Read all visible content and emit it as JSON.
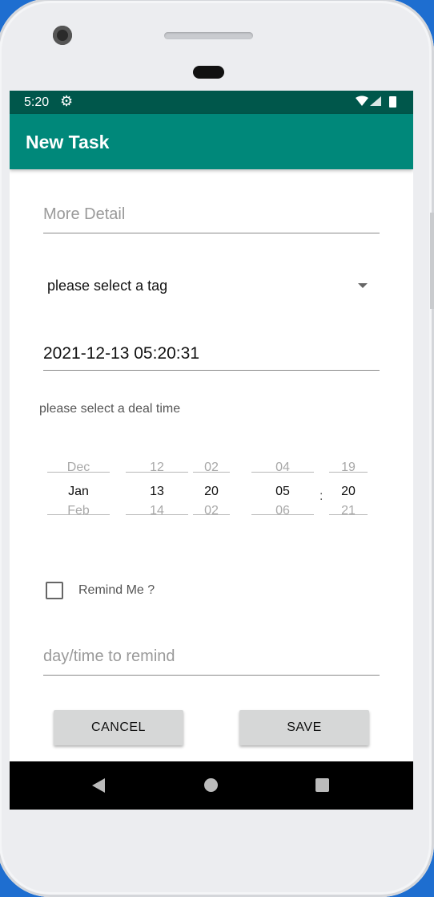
{
  "status_bar": {
    "time": "5:20"
  },
  "app_bar": {
    "title": "New Task"
  },
  "form": {
    "detail_placeholder": "More Detail",
    "tag_spinner_value": "please select a tag",
    "datetime_value": "2021-12-13 05:20:31",
    "deal_time_hint": "please select a deal time",
    "remind_label": "Remind Me ?",
    "remind_checked": false,
    "remind_placeholder": "day/time to remind"
  },
  "picker": {
    "month": {
      "prev": "Dec",
      "current": "Jan",
      "next": "Feb"
    },
    "day": {
      "prev": "12",
      "current": "13",
      "next": "14"
    },
    "year_part": {
      "prev": "02",
      "current": "20",
      "next": "02"
    },
    "hour": {
      "prev": "04",
      "current": "05",
      "next": "06"
    },
    "separator": ":",
    "minute": {
      "prev": "19",
      "current": "20",
      "next": "21"
    }
  },
  "buttons": {
    "cancel": "CANCEL",
    "save": "SAVE"
  },
  "colors": {
    "status_bar": "#00574b",
    "app_bar": "#00887a",
    "background": "#1e6ed0",
    "button": "#d6d7d7"
  },
  "icons": [
    "settings-gear-icon",
    "wifi-icon",
    "signal-icon",
    "battery-icon",
    "dropdown-arrow-icon",
    "back-icon",
    "home-icon",
    "recents-icon"
  ]
}
